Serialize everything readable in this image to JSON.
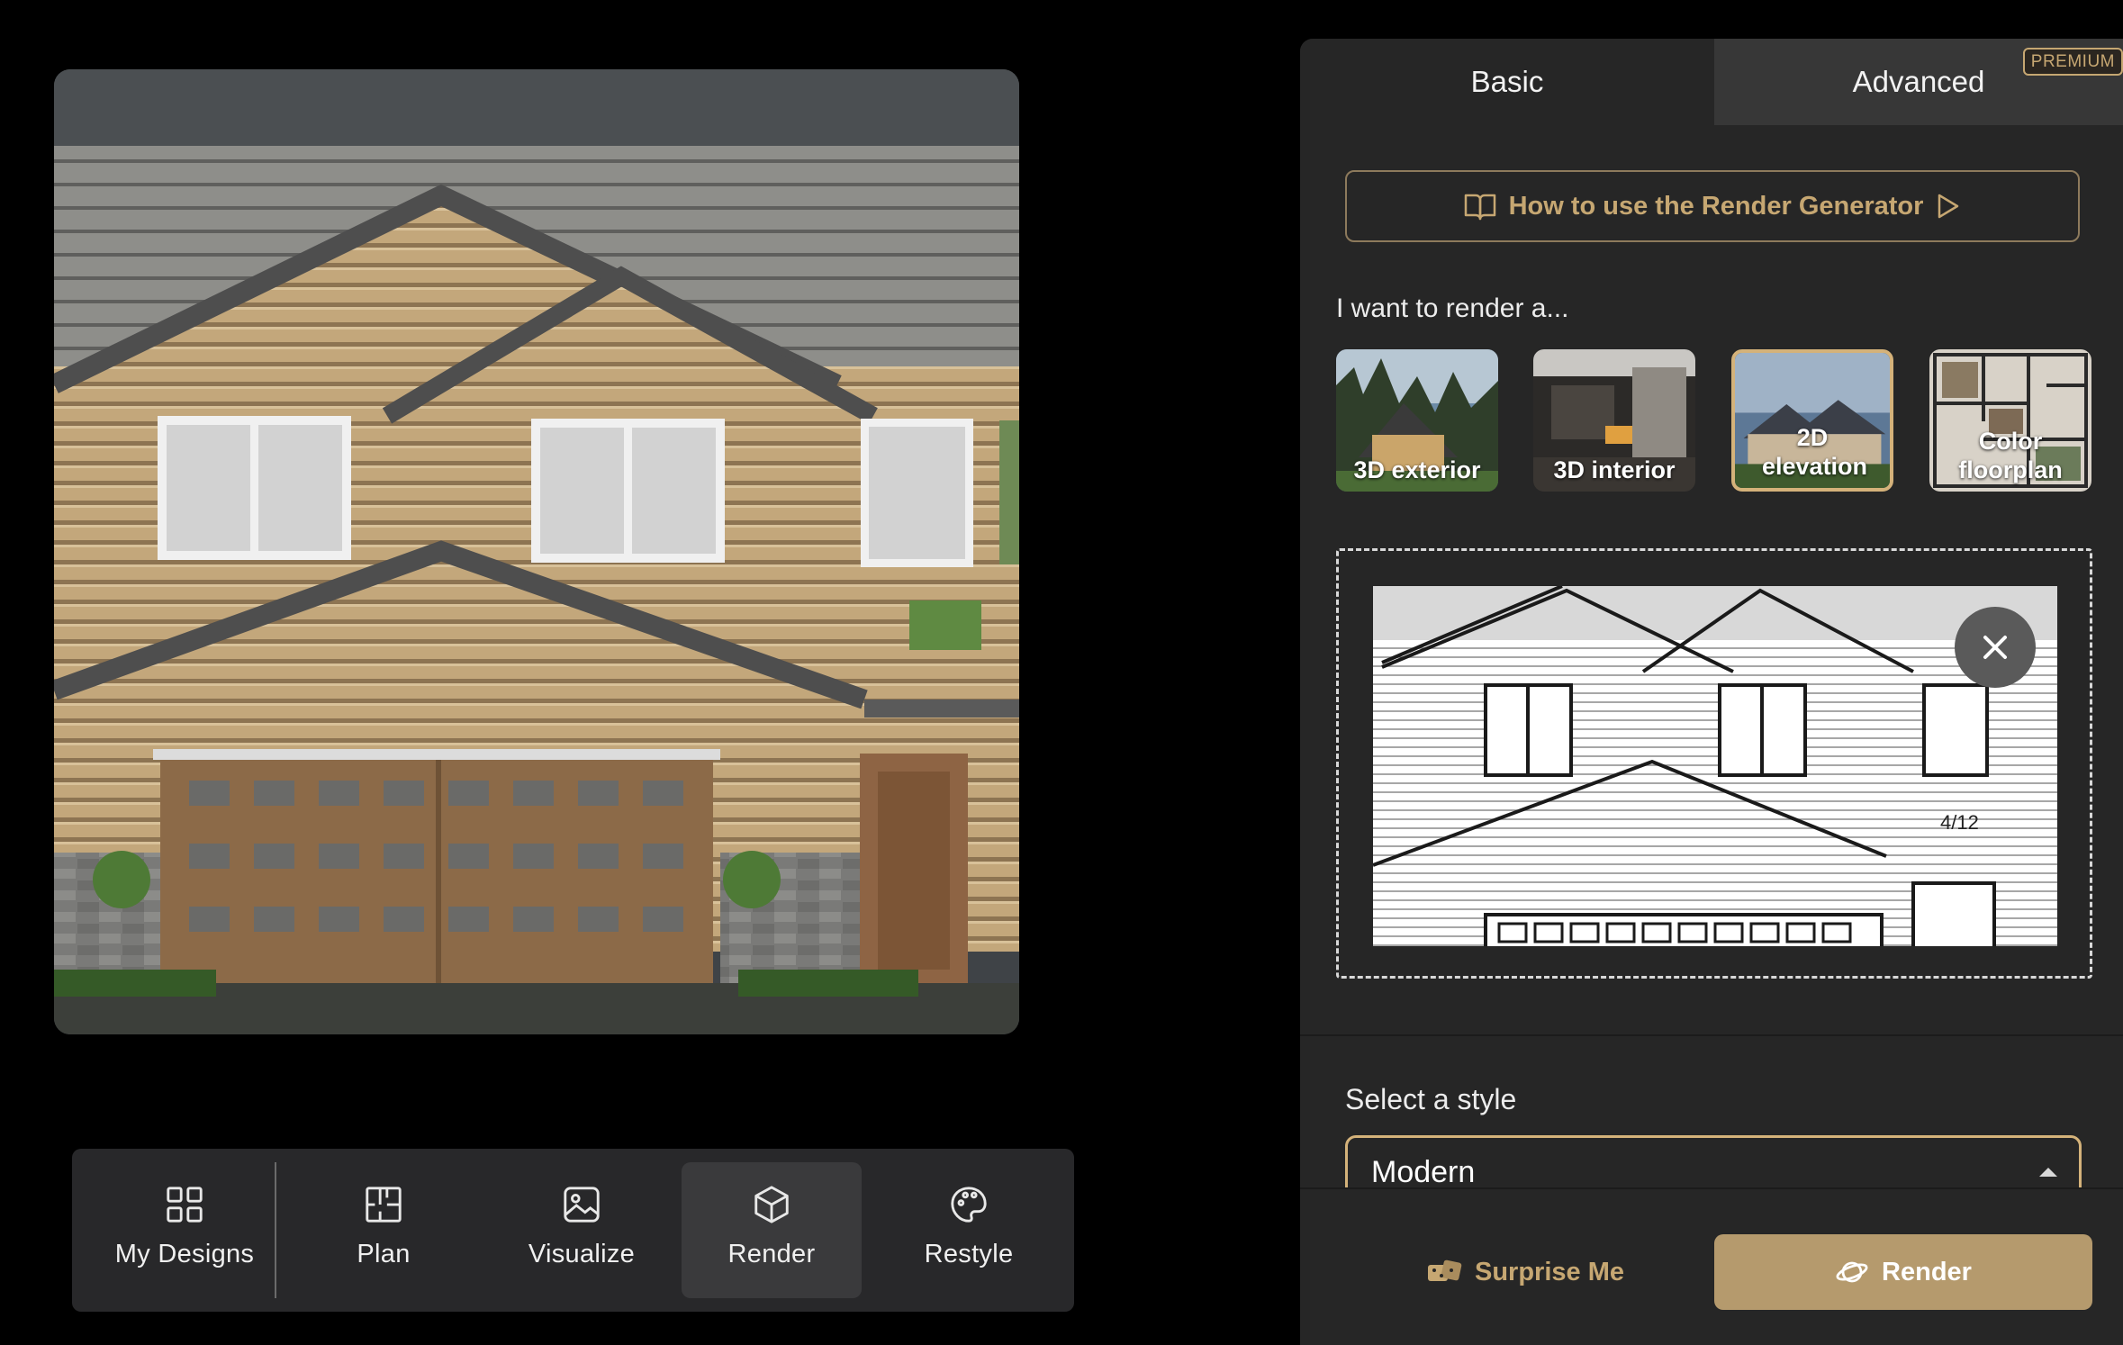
{
  "toolbar": {
    "items": [
      {
        "label": "My Designs",
        "icon": "grid-icon"
      },
      {
        "label": "Plan",
        "icon": "floorplan-icon"
      },
      {
        "label": "Visualize",
        "icon": "image-icon"
      },
      {
        "label": "Render",
        "icon": "cube-icon",
        "active": true
      },
      {
        "label": "Restyle",
        "icon": "palette-icon"
      }
    ]
  },
  "panel": {
    "tabs": [
      {
        "label": "Basic",
        "active": true
      },
      {
        "label": "Advanced",
        "badge": "PREMIUM"
      }
    ],
    "howto_label": "How to use the Render Generator",
    "want_label": "I want to render a...",
    "render_types": [
      {
        "label": "3D exterior"
      },
      {
        "label": "3D interior"
      },
      {
        "label": "2D elevation",
        "selected": true
      },
      {
        "label": "Color floorplan"
      }
    ],
    "upload": {
      "pitch_label": "4/12"
    },
    "style_label": "Select a style",
    "style_value": "Modern",
    "surprise_label": "Surprise Me",
    "render_label": "Render"
  },
  "colors": {
    "accent": "#c6a772",
    "render_button": "#b59a6d",
    "panel_bg": "#262626",
    "toolbar_bg": "#28282a"
  }
}
